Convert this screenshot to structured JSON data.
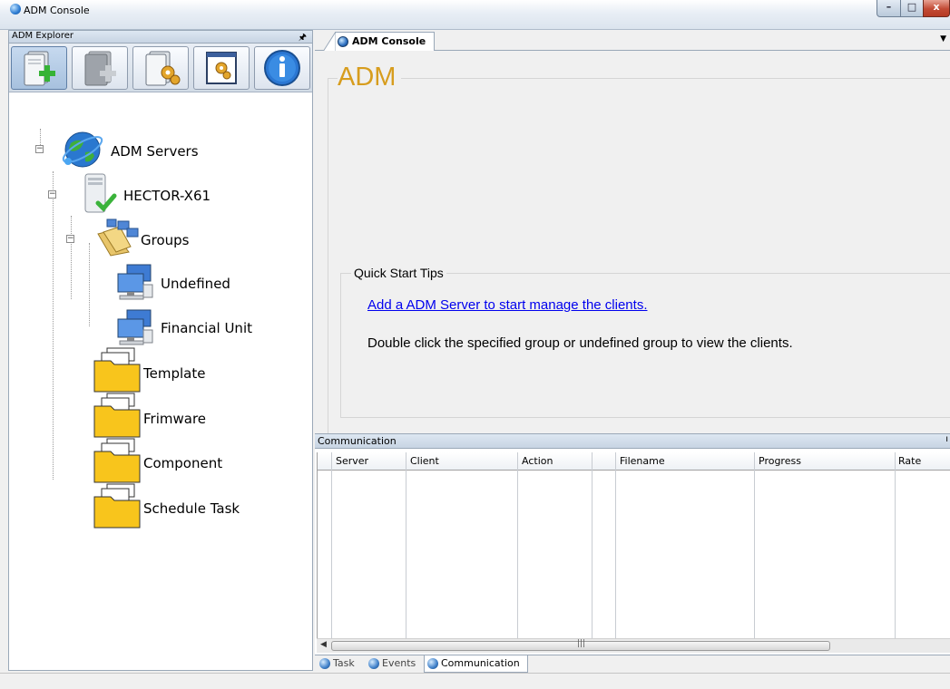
{
  "window": {
    "title": "ADM Console",
    "controls": {
      "minimize": "–",
      "maximize": "□",
      "close": "x"
    }
  },
  "explorer": {
    "title": "ADM Explorer",
    "pin_icon": "pin-icon",
    "toolbar": [
      {
        "name": "add-server",
        "icon": "server-add-icon",
        "pressed": true
      },
      {
        "name": "remove-server",
        "icon": "server-remove-icon",
        "pressed": false
      },
      {
        "name": "server-settings",
        "icon": "server-gear-icon",
        "pressed": false
      },
      {
        "name": "window-settings",
        "icon": "window-gear-icon",
        "pressed": false
      },
      {
        "name": "info",
        "icon": "info-icon",
        "pressed": false
      }
    ],
    "tree": {
      "root": "ADM Servers",
      "server": "HECTOR-X61",
      "groups": "Groups",
      "group_items": [
        "Undefined",
        "Financial Unit"
      ],
      "folders": [
        "Template",
        "Frimware",
        "Component",
        "Schedule Task"
      ]
    }
  },
  "document": {
    "tab_label": "ADM Console",
    "heading": "ADM",
    "tips_title": "Quick Start Tips",
    "tips_link": "Add a ADM Server to start manage the clients.",
    "tips_text": "Double click the specified group or undefined group to view the clients."
  },
  "communication": {
    "title": "Communication",
    "columns": [
      "Server",
      "Client",
      "Action",
      "",
      "Filename",
      "Progress",
      "Rate"
    ],
    "rows": []
  },
  "bottom_tabs": [
    "Task",
    "Events",
    "Communication"
  ],
  "colors": {
    "heading": "#d79d1e",
    "link": "#0000ee"
  }
}
